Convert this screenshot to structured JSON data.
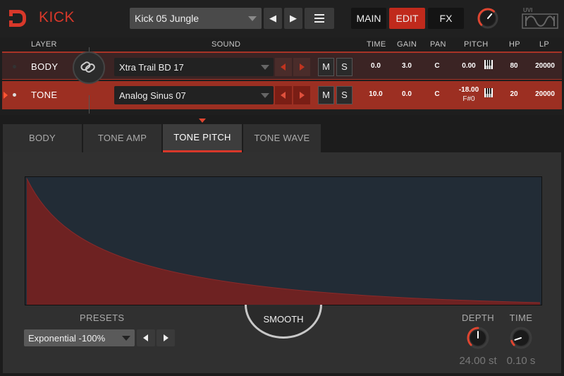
{
  "app": {
    "title": "KICK"
  },
  "header": {
    "preset_name": "Kick 05 Jungle",
    "prev_symbol": "◀",
    "next_symbol": "▶",
    "modes": [
      {
        "label": "MAIN",
        "active": false
      },
      {
        "label": "EDIT",
        "active": true
      },
      {
        "label": "FX",
        "active": false
      }
    ],
    "master_knob_level": 0.65
  },
  "layer_table": {
    "columns": {
      "layer": "LAYER",
      "sound": "SOUND",
      "time": "TIME",
      "gain": "GAIN",
      "pan": "PAN",
      "pitch": "PITCH",
      "hp": "HP",
      "lp": "LP"
    },
    "rows": [
      {
        "layer": "BODY",
        "sound": "Xtra Trail BD 17",
        "mute": "M",
        "solo": "S",
        "time": "0.0",
        "gain": "3.0",
        "pan": "C",
        "pitch": "0.00",
        "pitch_note": "",
        "hp": "80",
        "lp": "20000",
        "selected": false
      },
      {
        "layer": "TONE",
        "sound": "Analog Sinus 07",
        "mute": "M",
        "solo": "S",
        "time": "10.0",
        "gain": "0.0",
        "pan": "C",
        "pitch": "-18.00",
        "pitch_note": "F#0",
        "hp": "20",
        "lp": "20000",
        "selected": true
      }
    ]
  },
  "tabs": [
    {
      "label": "BODY",
      "active": false
    },
    {
      "label": "TONE AMP",
      "active": false
    },
    {
      "label": "TONE PITCH",
      "active": true
    },
    {
      "label": "TONE WAVE",
      "active": false
    }
  ],
  "tone_pitch": {
    "smooth_label": "SMOOTH",
    "presets_label": "PRESETS",
    "preset_value": "Exponential -100%",
    "depth": {
      "label": "DEPTH",
      "value": "24.00 st",
      "level": 0.5
    },
    "time": {
      "label": "TIME",
      "value": "0.10 s",
      "level": 0.1
    }
  },
  "colors": {
    "accent": "#d8382a",
    "envelope_fill": "#6e2222",
    "graph_bg": "#222c36",
    "tone_row": "#9c2f22"
  }
}
